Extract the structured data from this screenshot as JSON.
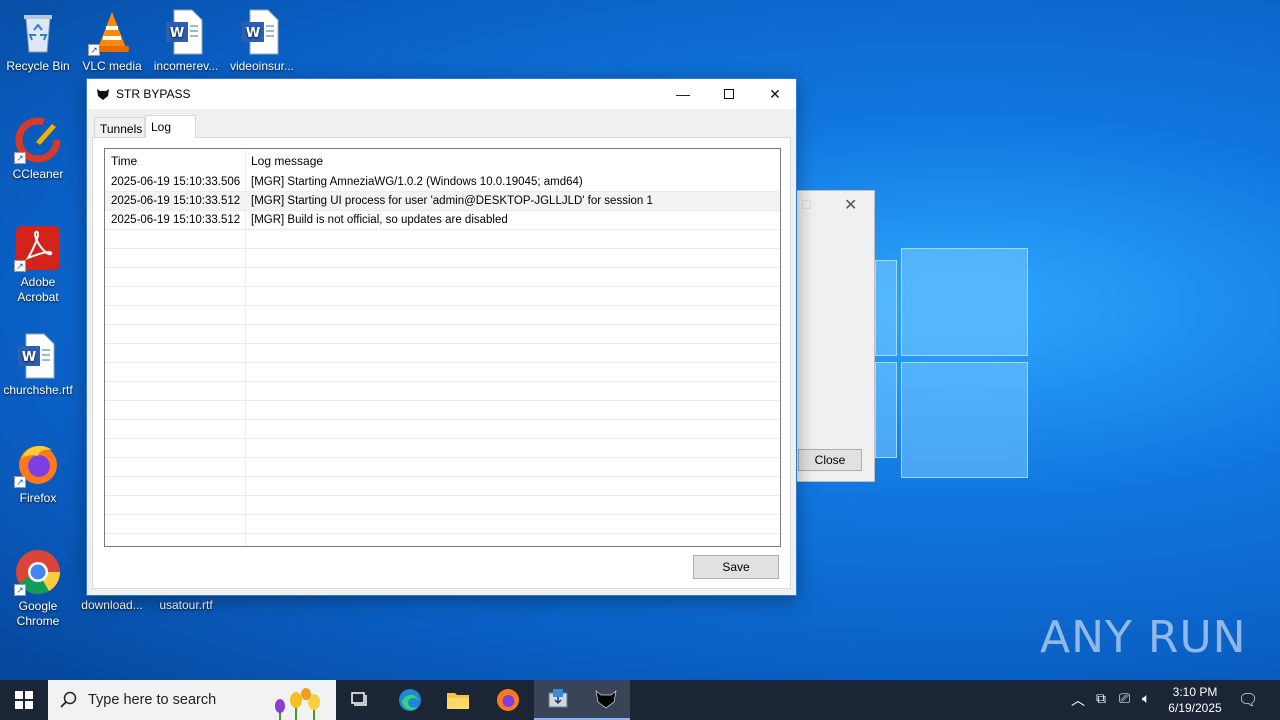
{
  "desktop": {
    "icons": [
      {
        "label": "Recycle Bin"
      },
      {
        "label": "VLC media"
      },
      {
        "label": "incomerev..."
      },
      {
        "label": "videoinsur..."
      },
      {
        "label": "CCleaner"
      },
      {
        "label": "Adobe Acrobat"
      },
      {
        "label": "churchshe.rtf"
      },
      {
        "label": "Firefox"
      },
      {
        "label": "Google Chrome"
      },
      {
        "label": "download..."
      },
      {
        "label": "usatour.rtf"
      }
    ],
    "watermark": "ANY RUN"
  },
  "window": {
    "title": "STR BYPASS",
    "tabs": [
      {
        "label": "Tunnels"
      },
      {
        "label": "Log"
      }
    ],
    "active_tab": "Log",
    "table": {
      "columns": [
        "Time",
        "Log message"
      ],
      "rows": [
        {
          "time": "2025-06-19 15:10:33.506",
          "message": "[MGR] Starting AmneziaWG/1.0.2 (Windows 10.0.19045; amd64)"
        },
        {
          "time": "2025-06-19 15:10:33.512",
          "message": "[MGR] Starting UI process for user 'admin@DESKTOP-JGLLJLD' for session 1"
        },
        {
          "time": "2025-06-19 15:10:33.512",
          "message": "[MGR] Build is not official, so updates are disabled"
        }
      ]
    },
    "save_label": "Save"
  },
  "background_dialog": {
    "close_label": "Close"
  },
  "taskbar": {
    "search_placeholder": "Type here to search",
    "time": "3:10 PM",
    "date": "6/19/2025"
  },
  "colors": {
    "accent": "#0078d7",
    "taskbar": "#1c2536",
    "window_border": "#2b7bd8"
  }
}
